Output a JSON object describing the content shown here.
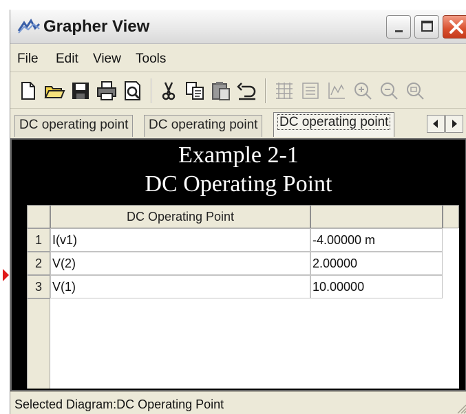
{
  "window": {
    "title": "Grapher View"
  },
  "menu": {
    "items": [
      "File",
      "Edit",
      "View",
      "Tools"
    ]
  },
  "toolbar": {
    "icons": [
      "new-icon",
      "open-icon",
      "save-icon",
      "print-icon",
      "print-preview-icon",
      "cut-icon",
      "copy-icon",
      "paste-icon",
      "undo-icon",
      "grid-icon",
      "list-icon",
      "chart-icon",
      "zoom-in-icon",
      "zoom-out-icon",
      "zoom-fit-icon"
    ]
  },
  "tabs": [
    {
      "label": "DC operating point"
    },
    {
      "label": "DC operating point"
    },
    {
      "label": "DC operating point",
      "active": true
    }
  ],
  "graph": {
    "title_line1": "Example 2-1",
    "title_line2": "DC Operating Point",
    "table": {
      "headers": [
        "DC Operating Point",
        ""
      ],
      "rows": [
        {
          "index": "1",
          "name": "I(v1)",
          "value": "-4.00000 m"
        },
        {
          "index": "2",
          "name": "V(2)",
          "value": "2.00000"
        },
        {
          "index": "3",
          "name": "V(1)",
          "value": "10.00000"
        }
      ],
      "selected_row": 3
    }
  },
  "status": {
    "text": "Selected Diagram:DC Operating Point"
  },
  "colors": {
    "background": "#000000",
    "chrome": "#ece9d8",
    "marker": "#e01a1a",
    "close_button": "#d9502f"
  }
}
